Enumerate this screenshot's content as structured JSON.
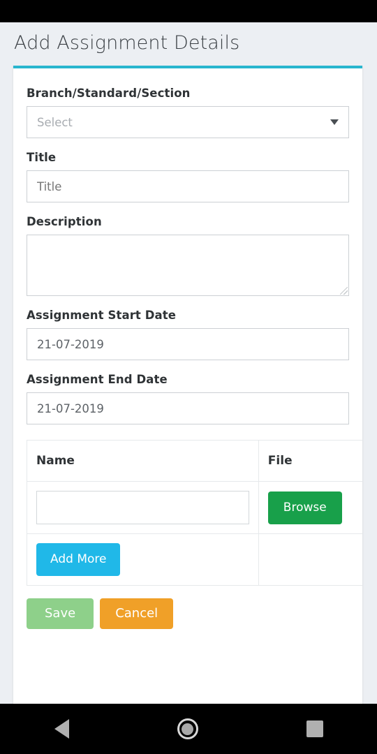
{
  "page": {
    "title": "Add Assignment Details",
    "accent_color": "#29b6ce",
    "background_color": "#eceff3"
  },
  "form": {
    "branch": {
      "label": "Branch/Standard/Section",
      "value": "Select",
      "arrow_icon": "chevron-down-icon"
    },
    "title": {
      "label": "Title",
      "value": "",
      "placeholder": "Title"
    },
    "description": {
      "label": "Description",
      "value": ""
    },
    "start_date": {
      "label": "Assignment Start Date",
      "value": "21-07-2019"
    },
    "end_date": {
      "label": "Assignment End Date",
      "value": "21-07-2019"
    }
  },
  "attachments": {
    "columns": [
      "Name",
      "File"
    ],
    "rows": [
      {
        "name": "",
        "file_button": "Browse"
      }
    ],
    "add_more_label": "Add More",
    "browse_color": "#18a04a",
    "add_more_color": "#20b8e8"
  },
  "actions": {
    "save_label": "Save",
    "cancel_label": "Cancel",
    "save_color": "#8ed08a",
    "cancel_color": "#f0a028"
  },
  "nav_bar": {
    "back_icon": "back-triangle-icon",
    "home_icon": "home-circle-icon",
    "recent_icon": "recent-square-icon"
  }
}
